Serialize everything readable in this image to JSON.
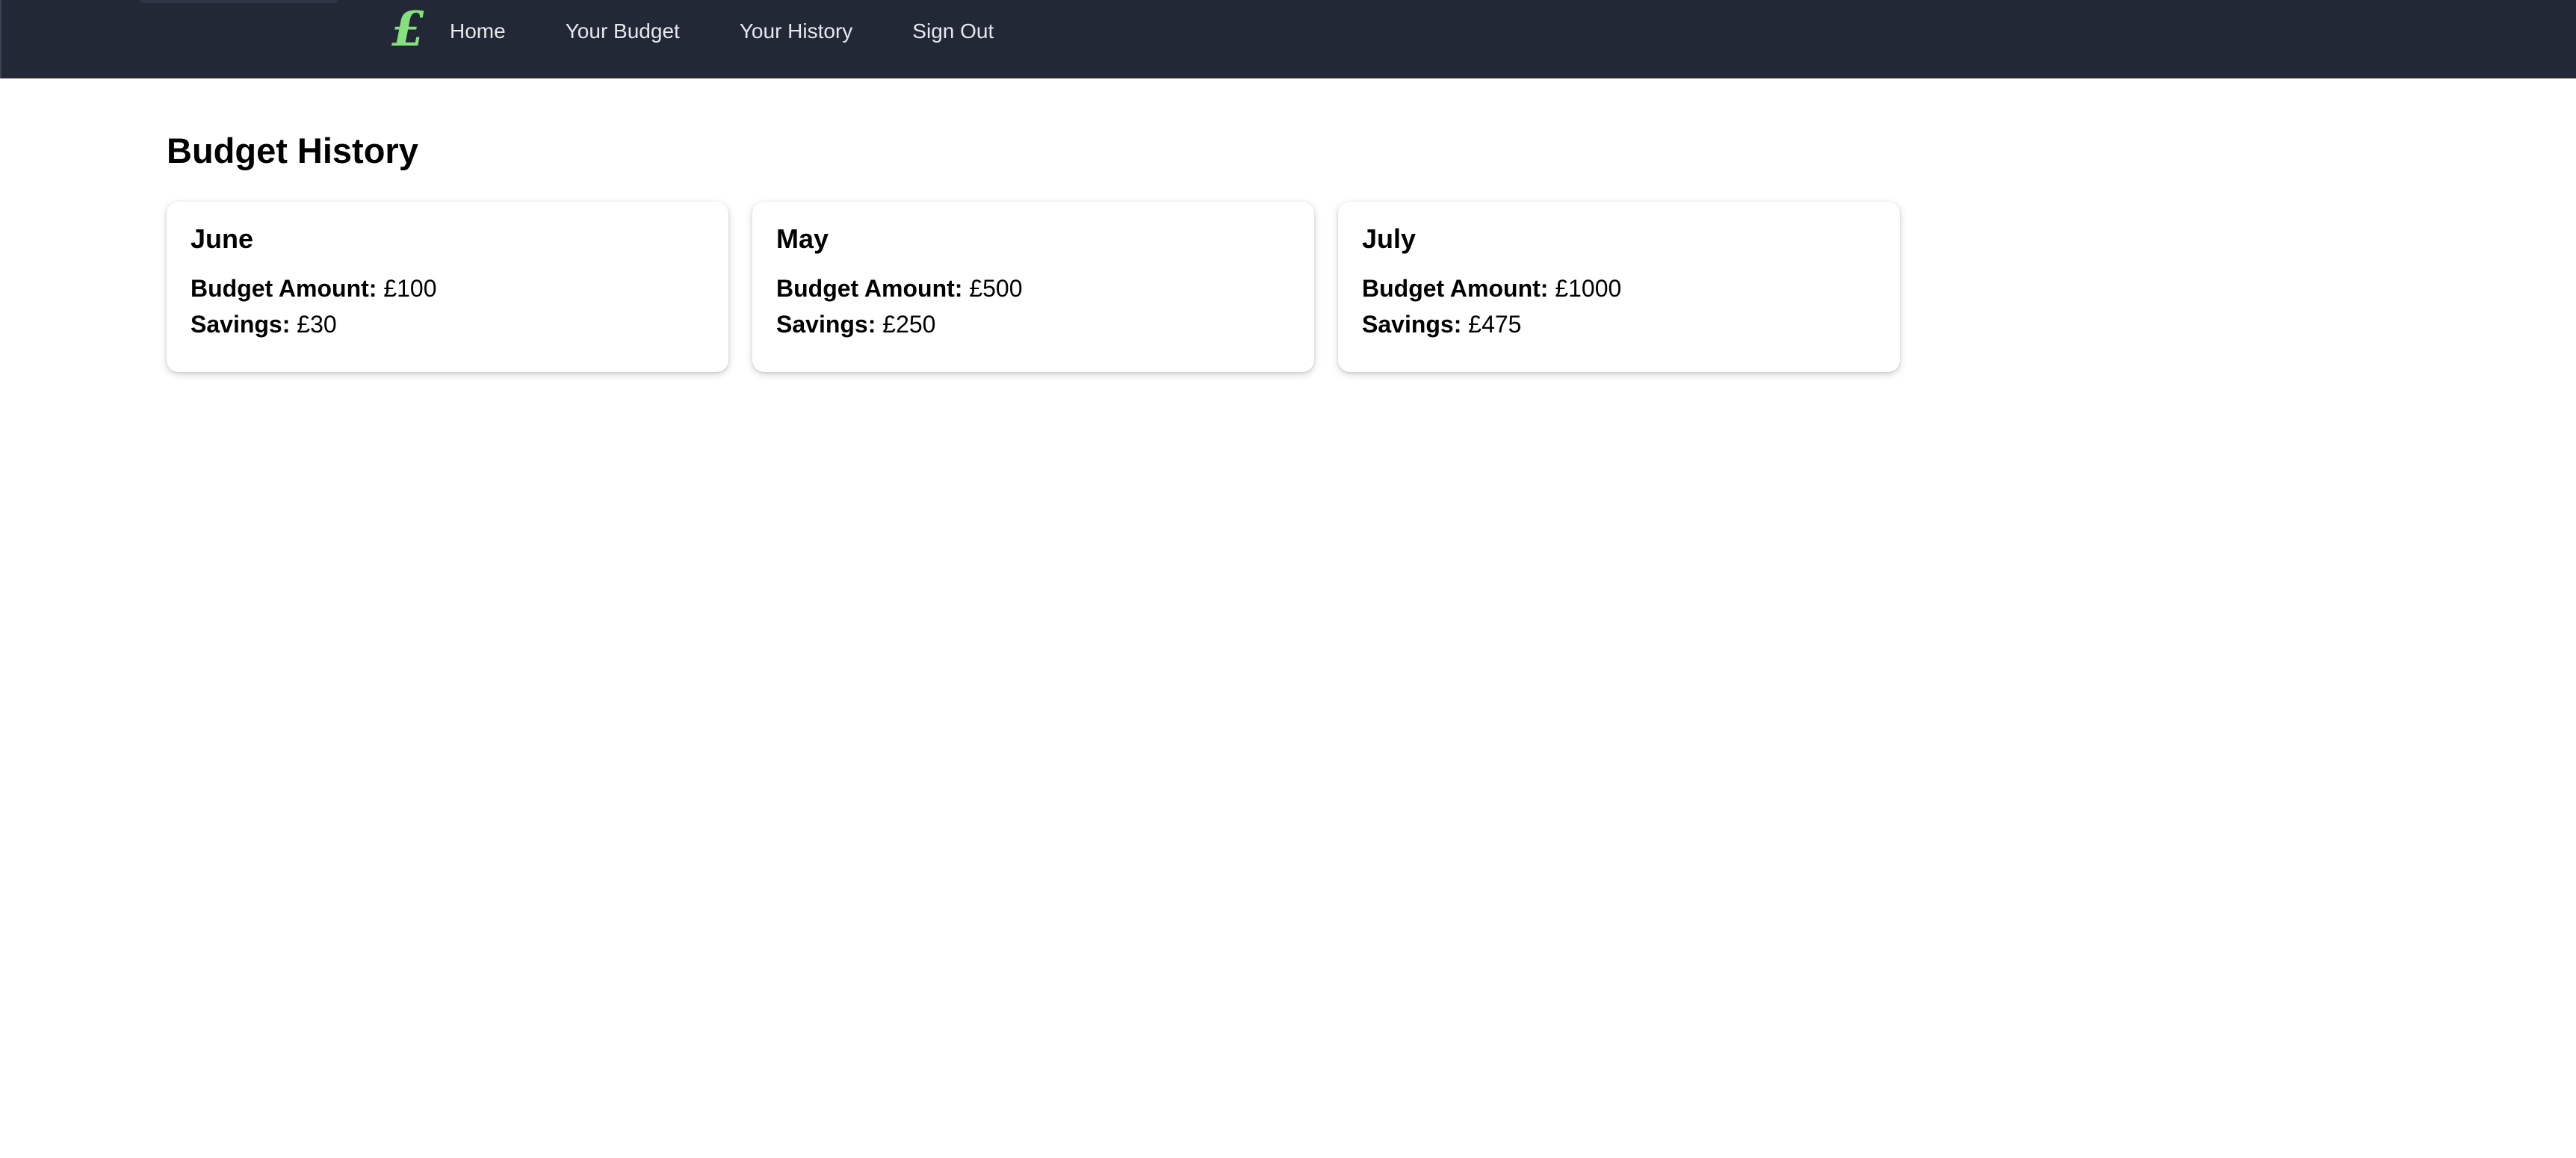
{
  "nav": {
    "logo_glyph": "£",
    "logo_color": "#86e07f",
    "background": "#222836",
    "links": [
      {
        "label": "Home"
      },
      {
        "label": "Your Budget"
      },
      {
        "label": "Your History"
      },
      {
        "label": "Sign Out"
      }
    ]
  },
  "main": {
    "title": "Budget History",
    "budget_label": "Budget Amount:",
    "savings_label": "Savings:",
    "cards": [
      {
        "month": "June",
        "budget": "£100",
        "savings": "£30"
      },
      {
        "month": "May",
        "budget": "£500",
        "savings": "£250"
      },
      {
        "month": "July",
        "budget": "£1000",
        "savings": "£475"
      }
    ]
  }
}
